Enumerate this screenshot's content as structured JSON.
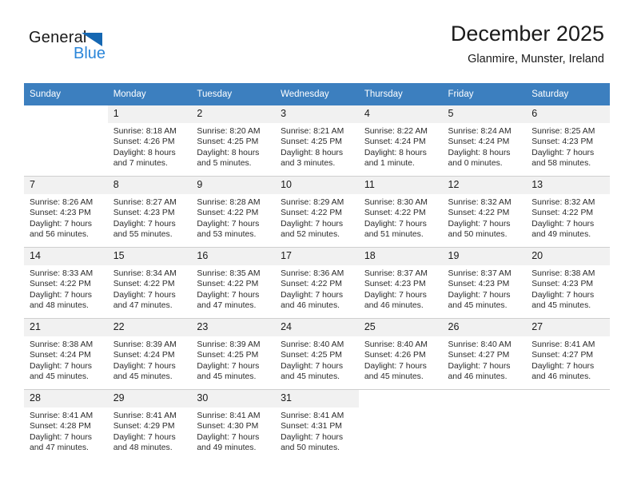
{
  "brand": {
    "name_part1": "General",
    "name_part2": "Blue",
    "triangle_icon": "triangle-icon",
    "accent_color": "#2b86d9",
    "triangle_color": "#1567b2"
  },
  "header": {
    "title": "December 2025",
    "subtitle": "Glanmire, Munster, Ireland"
  },
  "calendar": {
    "header_bg": "#3c7fbf",
    "daynum_bg": "#f1f1f1",
    "weekdays": [
      "Sunday",
      "Monday",
      "Tuesday",
      "Wednesday",
      "Thursday",
      "Friday",
      "Saturday"
    ],
    "weeks": [
      [
        {
          "day": "",
          "lines": []
        },
        {
          "day": "1",
          "lines": [
            "Sunrise: 8:18 AM",
            "Sunset: 4:26 PM",
            "Daylight: 8 hours",
            "and 7 minutes."
          ]
        },
        {
          "day": "2",
          "lines": [
            "Sunrise: 8:20 AM",
            "Sunset: 4:25 PM",
            "Daylight: 8 hours",
            "and 5 minutes."
          ]
        },
        {
          "day": "3",
          "lines": [
            "Sunrise: 8:21 AM",
            "Sunset: 4:25 PM",
            "Daylight: 8 hours",
            "and 3 minutes."
          ]
        },
        {
          "day": "4",
          "lines": [
            "Sunrise: 8:22 AM",
            "Sunset: 4:24 PM",
            "Daylight: 8 hours",
            "and 1 minute."
          ]
        },
        {
          "day": "5",
          "lines": [
            "Sunrise: 8:24 AM",
            "Sunset: 4:24 PM",
            "Daylight: 8 hours",
            "and 0 minutes."
          ]
        },
        {
          "day": "6",
          "lines": [
            "Sunrise: 8:25 AM",
            "Sunset: 4:23 PM",
            "Daylight: 7 hours",
            "and 58 minutes."
          ]
        }
      ],
      [
        {
          "day": "7",
          "lines": [
            "Sunrise: 8:26 AM",
            "Sunset: 4:23 PM",
            "Daylight: 7 hours",
            "and 56 minutes."
          ]
        },
        {
          "day": "8",
          "lines": [
            "Sunrise: 8:27 AM",
            "Sunset: 4:23 PM",
            "Daylight: 7 hours",
            "and 55 minutes."
          ]
        },
        {
          "day": "9",
          "lines": [
            "Sunrise: 8:28 AM",
            "Sunset: 4:22 PM",
            "Daylight: 7 hours",
            "and 53 minutes."
          ]
        },
        {
          "day": "10",
          "lines": [
            "Sunrise: 8:29 AM",
            "Sunset: 4:22 PM",
            "Daylight: 7 hours",
            "and 52 minutes."
          ]
        },
        {
          "day": "11",
          "lines": [
            "Sunrise: 8:30 AM",
            "Sunset: 4:22 PM",
            "Daylight: 7 hours",
            "and 51 minutes."
          ]
        },
        {
          "day": "12",
          "lines": [
            "Sunrise: 8:32 AM",
            "Sunset: 4:22 PM",
            "Daylight: 7 hours",
            "and 50 minutes."
          ]
        },
        {
          "day": "13",
          "lines": [
            "Sunrise: 8:32 AM",
            "Sunset: 4:22 PM",
            "Daylight: 7 hours",
            "and 49 minutes."
          ]
        }
      ],
      [
        {
          "day": "14",
          "lines": [
            "Sunrise: 8:33 AM",
            "Sunset: 4:22 PM",
            "Daylight: 7 hours",
            "and 48 minutes."
          ]
        },
        {
          "day": "15",
          "lines": [
            "Sunrise: 8:34 AM",
            "Sunset: 4:22 PM",
            "Daylight: 7 hours",
            "and 47 minutes."
          ]
        },
        {
          "day": "16",
          "lines": [
            "Sunrise: 8:35 AM",
            "Sunset: 4:22 PM",
            "Daylight: 7 hours",
            "and 47 minutes."
          ]
        },
        {
          "day": "17",
          "lines": [
            "Sunrise: 8:36 AM",
            "Sunset: 4:22 PM",
            "Daylight: 7 hours",
            "and 46 minutes."
          ]
        },
        {
          "day": "18",
          "lines": [
            "Sunrise: 8:37 AM",
            "Sunset: 4:23 PM",
            "Daylight: 7 hours",
            "and 46 minutes."
          ]
        },
        {
          "day": "19",
          "lines": [
            "Sunrise: 8:37 AM",
            "Sunset: 4:23 PM",
            "Daylight: 7 hours",
            "and 45 minutes."
          ]
        },
        {
          "day": "20",
          "lines": [
            "Sunrise: 8:38 AM",
            "Sunset: 4:23 PM",
            "Daylight: 7 hours",
            "and 45 minutes."
          ]
        }
      ],
      [
        {
          "day": "21",
          "lines": [
            "Sunrise: 8:38 AM",
            "Sunset: 4:24 PM",
            "Daylight: 7 hours",
            "and 45 minutes."
          ]
        },
        {
          "day": "22",
          "lines": [
            "Sunrise: 8:39 AM",
            "Sunset: 4:24 PM",
            "Daylight: 7 hours",
            "and 45 minutes."
          ]
        },
        {
          "day": "23",
          "lines": [
            "Sunrise: 8:39 AM",
            "Sunset: 4:25 PM",
            "Daylight: 7 hours",
            "and 45 minutes."
          ]
        },
        {
          "day": "24",
          "lines": [
            "Sunrise: 8:40 AM",
            "Sunset: 4:25 PM",
            "Daylight: 7 hours",
            "and 45 minutes."
          ]
        },
        {
          "day": "25",
          "lines": [
            "Sunrise: 8:40 AM",
            "Sunset: 4:26 PM",
            "Daylight: 7 hours",
            "and 45 minutes."
          ]
        },
        {
          "day": "26",
          "lines": [
            "Sunrise: 8:40 AM",
            "Sunset: 4:27 PM",
            "Daylight: 7 hours",
            "and 46 minutes."
          ]
        },
        {
          "day": "27",
          "lines": [
            "Sunrise: 8:41 AM",
            "Sunset: 4:27 PM",
            "Daylight: 7 hours",
            "and 46 minutes."
          ]
        }
      ],
      [
        {
          "day": "28",
          "lines": [
            "Sunrise: 8:41 AM",
            "Sunset: 4:28 PM",
            "Daylight: 7 hours",
            "and 47 minutes."
          ]
        },
        {
          "day": "29",
          "lines": [
            "Sunrise: 8:41 AM",
            "Sunset: 4:29 PM",
            "Daylight: 7 hours",
            "and 48 minutes."
          ]
        },
        {
          "day": "30",
          "lines": [
            "Sunrise: 8:41 AM",
            "Sunset: 4:30 PM",
            "Daylight: 7 hours",
            "and 49 minutes."
          ]
        },
        {
          "day": "31",
          "lines": [
            "Sunrise: 8:41 AM",
            "Sunset: 4:31 PM",
            "Daylight: 7 hours",
            "and 50 minutes."
          ]
        },
        {
          "day": "",
          "lines": []
        },
        {
          "day": "",
          "lines": []
        },
        {
          "day": "",
          "lines": []
        }
      ]
    ]
  }
}
